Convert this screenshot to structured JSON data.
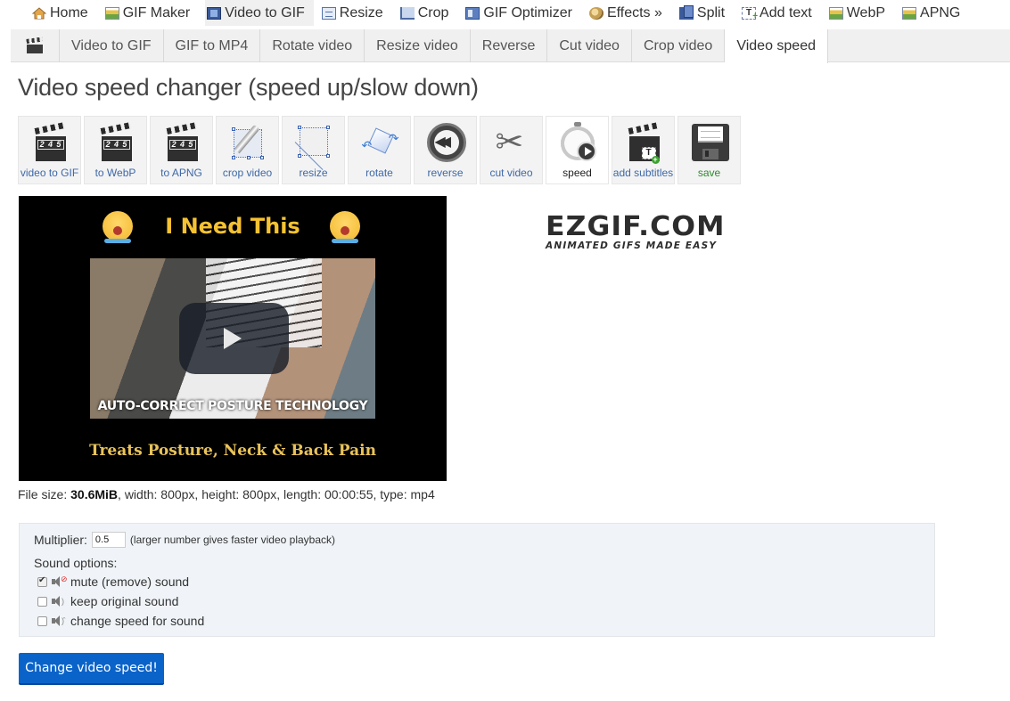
{
  "topnav": {
    "items": [
      {
        "label": "Home",
        "icon": "home-icon"
      },
      {
        "label": "GIF Maker",
        "icon": "image-icon"
      },
      {
        "label": "Video to GIF",
        "icon": "film-icon",
        "active": true
      },
      {
        "label": "Resize",
        "icon": "resize-icon"
      },
      {
        "label": "Crop",
        "icon": "crop-icon"
      },
      {
        "label": "GIF Optimizer",
        "icon": "optimizer-icon"
      },
      {
        "label": "Effects »",
        "icon": "effects-icon"
      },
      {
        "label": "Split",
        "icon": "split-icon"
      },
      {
        "label": "Add text",
        "icon": "add-text-icon"
      },
      {
        "label": "WebP",
        "icon": "image-icon"
      },
      {
        "label": "APNG",
        "icon": "image-icon"
      }
    ]
  },
  "subnav": {
    "icon": "clapperboard-icon",
    "tabs": [
      {
        "label": "Video to GIF"
      },
      {
        "label": "GIF to MP4"
      },
      {
        "label": "Rotate video"
      },
      {
        "label": "Resize video"
      },
      {
        "label": "Reverse"
      },
      {
        "label": "Cut video"
      },
      {
        "label": "Crop video"
      },
      {
        "label": "Video speed",
        "active": true
      }
    ]
  },
  "page": {
    "title": "Video speed changer (speed up/slow down)"
  },
  "toolbar": {
    "tools": [
      {
        "label": "video to GIF",
        "icon": "clapperboard-icon"
      },
      {
        "label": "to WebP",
        "icon": "clapperboard-icon"
      },
      {
        "label": "to APNG",
        "icon": "clapperboard-icon"
      },
      {
        "label": "crop video",
        "icon": "crop-icon"
      },
      {
        "label": "resize",
        "icon": "resize-icon"
      },
      {
        "label": "rotate",
        "icon": "rotate-icon"
      },
      {
        "label": "reverse",
        "icon": "rewind-icon"
      },
      {
        "label": "cut video",
        "icon": "scissors-icon"
      },
      {
        "label": "speed",
        "icon": "stopwatch-icon",
        "active": true
      },
      {
        "label": "add subtitles",
        "icon": "subtitles-icon"
      },
      {
        "label": "save",
        "icon": "floppy-icon"
      }
    ],
    "clap_digits": [
      "2",
      "4",
      "5"
    ],
    "subtitle_glyph": "T"
  },
  "video": {
    "headline": "I Need This",
    "caption": "AUTO-CORRECT POSTURE TECHNOLOGY",
    "tagline": "Treats Posture, Neck & Back Pain"
  },
  "logo": {
    "name": "EZGIF.COM",
    "slogan": "ANIMATED GIFS MADE EASY"
  },
  "fileinfo": {
    "size_label": "File size: ",
    "size_value": "30.6MiB",
    "rest": ", width: 800px, height: 800px, length: 00:00:55, type: mp4"
  },
  "options": {
    "multiplier_label": "Multiplier:",
    "multiplier_value": "0.5",
    "multiplier_hint": "(larger number gives faster video playback)",
    "sound_label": "Sound options:",
    "sound_options": [
      {
        "label": "mute (remove) sound",
        "checked": true
      },
      {
        "label": "keep original sound",
        "checked": false
      },
      {
        "label": "change speed for sound",
        "checked": false
      }
    ]
  },
  "submit": {
    "label": "Change video speed!"
  },
  "colors": {
    "accent": "#0a63c9",
    "link": "#3d68a8",
    "save": "#2c8a2c",
    "headline": "#f6c232"
  }
}
